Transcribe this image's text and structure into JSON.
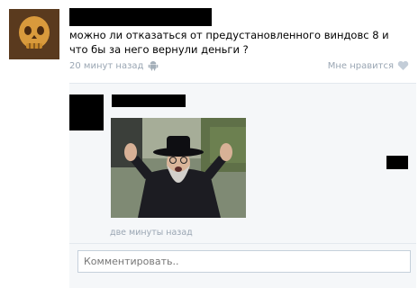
{
  "post": {
    "author_redacted": true,
    "text": "можно ли отказаться от предустановленного виндовс 8 и что бы за него вернули деньги ?",
    "time": "20 минут назад",
    "like_label": "Мне нравится",
    "platform_icon": "android-icon",
    "like_icon": "heart-icon"
  },
  "reply": {
    "author_redacted": true,
    "avatar_redacted": true,
    "time": "две минуты назад",
    "photo": "photo"
  },
  "comment": {
    "placeholder": "Комментировать.."
  },
  "colors": {
    "meta_text": "#9aa6b3",
    "reply_bg": "#f5f7f9",
    "input_border": "#c5d0db"
  }
}
